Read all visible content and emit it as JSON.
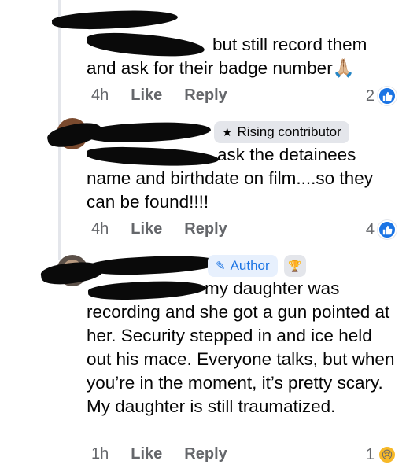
{
  "comments": [
    {
      "text": "but still record them and ask for their badge number🙏🏼",
      "time": "4h",
      "like_label": "Like",
      "reply_label": "Reply",
      "reaction_count": "2",
      "reaction_icon": "like-icon"
    },
    {
      "badge_label": "Rising contributor",
      "badge_icon": "star-icon",
      "text": "ask the detainees name and birthdate on film....so they can be found!!!!",
      "time": "4h",
      "like_label": "Like",
      "reply_label": "Reply",
      "reaction_count": "4",
      "reaction_icon": "like-icon"
    },
    {
      "badge_label": "Author",
      "badge_icon": "pencil-icon",
      "extra_badge_icon": "trophy-icon",
      "text": "my daughter was recording and she got a gun pointed at her. Security stepped in and ice held out his  mace. Everyone talks, but when you’re in the moment, it’s pretty scary. My daughter is still traumatized.",
      "time": "1h",
      "like_label": "Like",
      "reply_label": "Reply",
      "reaction_count": "1",
      "reaction_icon": "sad-face-icon"
    }
  ],
  "colors": {
    "accent": "#1b74e4",
    "muted": "#65676b",
    "badge_bg": "#e4e6eb"
  }
}
